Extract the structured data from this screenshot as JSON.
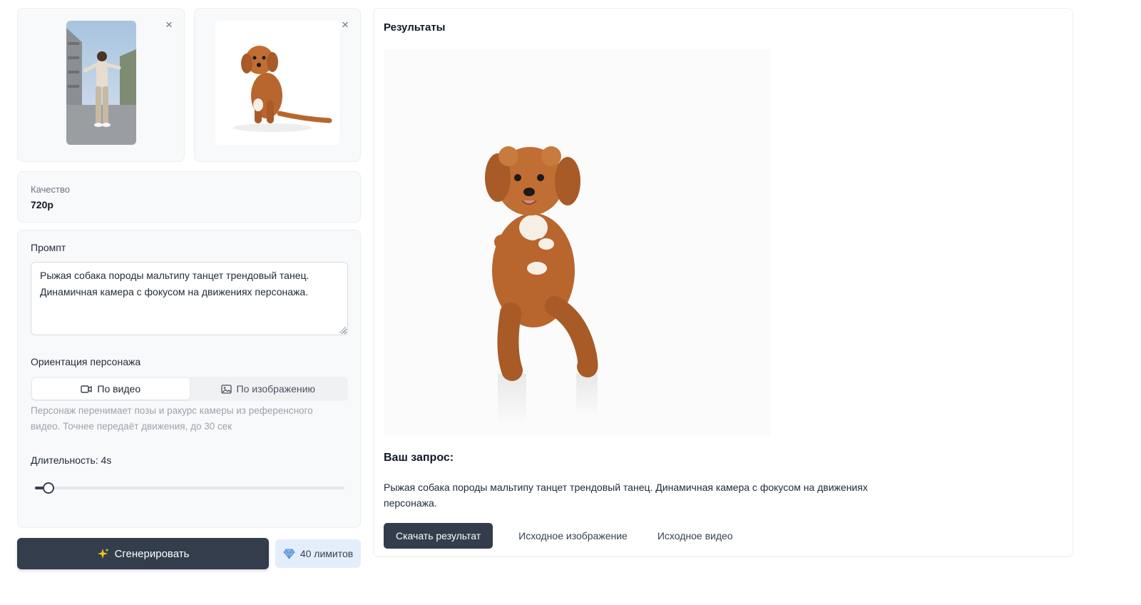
{
  "uploads": [
    {
      "name": "source-video",
      "remove_label": "×"
    },
    {
      "name": "source-image",
      "remove_label": "×"
    }
  ],
  "quality": {
    "label": "Качество",
    "value": "720p"
  },
  "prompt": {
    "label": "Промпт",
    "value": "Рыжая собака породы мальтипу танцет трендовый танец. Динамичная камера с фокусом на движениях персонажа."
  },
  "orientation": {
    "label": "Ориентация персонажа",
    "options": [
      {
        "label": "По видео",
        "icon": "video-icon",
        "active": true
      },
      {
        "label": "По изображению",
        "icon": "image-icon",
        "active": false
      }
    ],
    "hint": "Персонаж перенимает позы и ракурс камеры из референсного видео. Точнее передаёт движения, до 30 сек"
  },
  "duration": {
    "label": "Длительность: 4s",
    "value_seconds": 4,
    "slider_fraction": 0.03
  },
  "generate": {
    "label": "Сгенерировать",
    "icon": "sparkles-icon"
  },
  "limits": {
    "label": "40 лимитов",
    "icon": "diamond-icon"
  },
  "results": {
    "title": "Результаты",
    "request_title": "Ваш запрос:",
    "request_text": "Рыжая собака породы мальтипу танцет трендовый танец. Динамичная камера с фокусом на движениях персонажа.",
    "download_label": "Скачать результат",
    "source_image_label": "Исходное изображение",
    "source_video_label": "Исходное видео"
  },
  "colors": {
    "primary_button": "#333d4c",
    "limits_bg": "#e4eefb",
    "dog_fur": "#b8652e"
  }
}
